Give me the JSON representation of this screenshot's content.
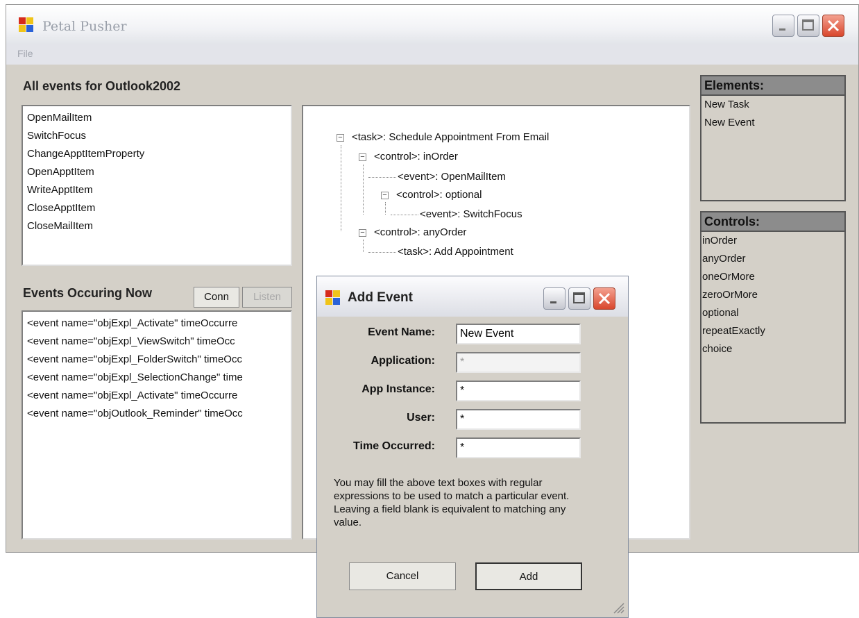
{
  "window": {
    "title": "Petal Pusher",
    "menu": [
      "File"
    ]
  },
  "events_panel": {
    "heading": "All events for Outlook2002",
    "items": [
      "OpenMailItem",
      "SwitchFocus",
      "ChangeApptItemProperty",
      "OpenApptItem",
      "WriteApptItem",
      "CloseApptItem",
      "CloseMailItem"
    ]
  },
  "now_panel": {
    "heading": "Events Occuring Now",
    "conn_label": "Conn",
    "listen_label": "Listen",
    "items": [
      "<event name=\"objExpl_Activate\" timeOccurre",
      "<event name=\"objExpl_ViewSwitch\" timeOcc",
      "<event name=\"objExpl_FolderSwitch\" timeOcc",
      "<event name=\"objExpl_SelectionChange\" time",
      "<event name=\"objExpl_Activate\" timeOccurre",
      "<event name=\"objOutlook_Reminder\" timeOcc"
    ]
  },
  "tree": {
    "nodes": [
      "<task>: Schedule Appointment From Email",
      "<control>: inOrder",
      "<event>: OpenMailItem",
      "<control>: optional",
      "<event>: SwitchFocus",
      "<control>: anyOrder",
      "<task>: Add Appointment"
    ]
  },
  "elements_panel": {
    "heading": "Elements:",
    "items": [
      "New Task",
      "New Event"
    ]
  },
  "controls_panel": {
    "heading": "Controls:",
    "items": [
      "inOrder",
      "anyOrder",
      "oneOrMore",
      "zeroOrMore",
      "optional",
      "repeatExactly",
      "choice"
    ]
  },
  "dialog": {
    "title": "Add Event",
    "fields": [
      {
        "label": "Event Name:",
        "value": "New Event"
      },
      {
        "label": "Application:",
        "value": "*"
      },
      {
        "label": "App Instance:",
        "value": "*"
      },
      {
        "label": "User:",
        "value": "*"
      },
      {
        "label": "Time Occurred:",
        "value": "*"
      }
    ],
    "help_text": "You may fill the above text boxes with regular expressions to be used to match a particular event. Leaving a field blank is equivalent to matching any value.",
    "cancel_label": "Cancel",
    "add_label": "Add"
  },
  "colors": {
    "window_bg": "#d4d0c8",
    "close_red": "#d9472d",
    "panel_header": "#8c8c8c"
  }
}
